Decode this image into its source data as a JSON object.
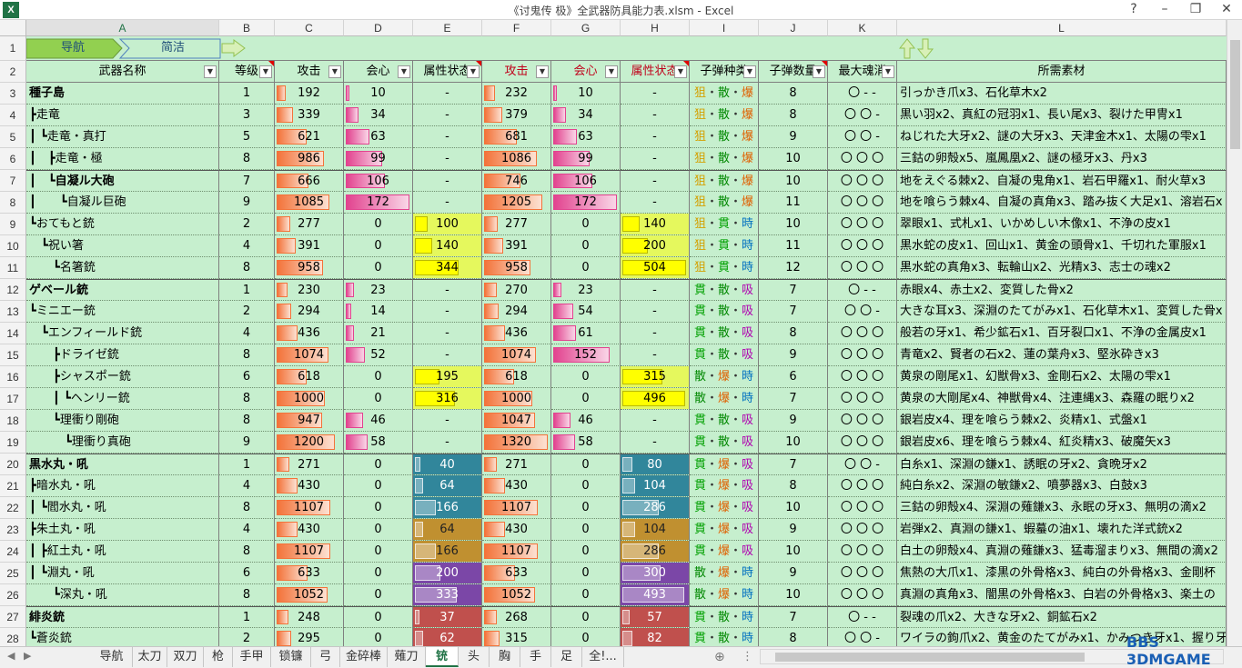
{
  "window": {
    "title": "《讨鬼传 极》全武器防具能力表.xlsm - Excel",
    "app_icon": "excel-icon",
    "buttons": [
      "?",
      "–",
      "❐",
      "✕"
    ]
  },
  "columns": [
    "A",
    "B",
    "C",
    "D",
    "E",
    "F",
    "G",
    "H",
    "I",
    "J",
    "K",
    "L"
  ],
  "row_numbers": [
    "1",
    "2",
    "3",
    "4",
    "5",
    "6",
    "7",
    "8",
    "9",
    "10",
    "11",
    "12",
    "13",
    "14",
    "15",
    "16",
    "17",
    "18",
    "19",
    "20",
    "21",
    "22",
    "23",
    "24",
    "25",
    "26",
    "27",
    "28"
  ],
  "nav": {
    "nav_label": "导航",
    "simple_label": "简洁"
  },
  "headers": [
    "武器名称",
    "等级",
    "攻击",
    "会心",
    "属性状态",
    "攻击",
    "会心",
    "属性状态",
    "子弹种类",
    "子弹数量",
    "最大魂消",
    "所需素材"
  ],
  "rows": [
    {
      "name": "種子島",
      "lv": "1",
      "atk": "192",
      "crit": "10",
      "attr": "-",
      "atk2": "232",
      "crit2": "10",
      "attr2": "-",
      "bullet": [
        "狙",
        "散",
        "爆"
      ],
      "count": "8",
      "soul": "〇 - -",
      "mat": "引っかき爪x3、石化草木x2",
      "bold": true
    },
    {
      "name": "┣走竜",
      "lv": "3",
      "atk": "339",
      "crit": "34",
      "attr": "-",
      "atk2": "379",
      "crit2": "34",
      "attr2": "-",
      "bullet": [
        "狙",
        "散",
        "爆"
      ],
      "count": "8",
      "soul": "〇 〇 -",
      "mat": "黒い羽x2、真紅の冠羽x1、長い尾x3、裂けた甲冑x1"
    },
    {
      "name": "┃ ┗走竜・真打",
      "lv": "5",
      "atk": "621",
      "crit": "63",
      "attr": "-",
      "atk2": "681",
      "crit2": "63",
      "attr2": "-",
      "bullet": [
        "狙",
        "散",
        "爆"
      ],
      "count": "9",
      "soul": "〇 〇 -",
      "mat": "ねじれた大牙x2、謎の大牙x3、天津金木x1、太陽の雫x1"
    },
    {
      "name": "┃　┣走竜・極",
      "lv": "8",
      "atk": "986",
      "crit": "99",
      "attr": "-",
      "atk2": "1086",
      "crit2": "99",
      "attr2": "-",
      "bullet": [
        "狙",
        "散",
        "爆"
      ],
      "count": "10",
      "soul": "〇 〇 〇",
      "mat": "三鈷の卵殻x5、嵐鳳凰x2、謎の極牙x3、丹x3"
    },
    {
      "name": "┃　┗自凝ル大砲",
      "lv": "7",
      "atk": "666",
      "crit": "106",
      "attr": "-",
      "atk2": "746",
      "crit2": "106",
      "attr2": "-",
      "bullet": [
        "狙",
        "散",
        "爆"
      ],
      "count": "10",
      "soul": "〇 〇 〇",
      "mat": "地をえぐる棘x2、自凝の鬼角x1、岩石甲羅x1、耐火草x3",
      "bold": true
    },
    {
      "name": "┃　　┗自凝ル巨砲",
      "lv": "9",
      "atk": "1085",
      "crit": "172",
      "attr": "-",
      "atk2": "1205",
      "crit2": "172",
      "attr2": "-",
      "bullet": [
        "狙",
        "散",
        "爆"
      ],
      "count": "11",
      "soul": "〇 〇 〇",
      "mat": "地を喰らう棘x4、自凝の真角x3、踏み抜く大足x1、溶岩石x"
    },
    {
      "name": "┗おてもと銃",
      "lv": "2",
      "atk": "277",
      "crit": "0",
      "attr": "100",
      "atk2": "277",
      "crit2": "0",
      "attr2": "140",
      "bullet": [
        "狙",
        "貫",
        "時"
      ],
      "count": "10",
      "soul": "〇 〇 〇",
      "mat": "翠眼x1、式札x1、いかめしい木像x1、不浄の皮x1"
    },
    {
      "name": "　┗祝い箸",
      "lv": "4",
      "atk": "391",
      "crit": "0",
      "attr": "140",
      "atk2": "391",
      "crit2": "0",
      "attr2": "200",
      "bullet": [
        "狙",
        "貫",
        "時"
      ],
      "count": "11",
      "soul": "〇 〇 〇",
      "mat": "黒水蛇の皮x1、回山x1、黄金の頭骨x1、千切れた軍服x1"
    },
    {
      "name": "　　┗名箸銃",
      "lv": "8",
      "atk": "958",
      "crit": "0",
      "attr": "344",
      "atk2": "958",
      "crit2": "0",
      "attr2": "504",
      "bullet": [
        "狙",
        "貫",
        "時"
      ],
      "count": "12",
      "soul": "〇 〇 〇",
      "mat": "黒水蛇の真角x3、転輪山x2、光精x3、志士の魂x2"
    },
    {
      "name": "ゲベール銃",
      "lv": "1",
      "atk": "230",
      "crit": "23",
      "attr": "-",
      "atk2": "270",
      "crit2": "23",
      "attr2": "-",
      "bullet": [
        "貫",
        "散",
        "吸"
      ],
      "count": "7",
      "soul": "〇 - -",
      "mat": "赤眼x4、赤土x2、変質した骨x2",
      "bold": true
    },
    {
      "name": "┗ミニエー銃",
      "lv": "2",
      "atk": "294",
      "crit": "14",
      "attr": "-",
      "atk2": "294",
      "crit2": "54",
      "attr2": "-",
      "bullet": [
        "貫",
        "散",
        "吸"
      ],
      "count": "7",
      "soul": "〇 〇 -",
      "mat": "大きな耳x3、深淵のたてがみx1、石化草木x1、変質した骨x"
    },
    {
      "name": "　┗エンフィールド銃",
      "lv": "4",
      "atk": "436",
      "crit": "21",
      "attr": "-",
      "atk2": "436",
      "crit2": "61",
      "attr2": "-",
      "bullet": [
        "貫",
        "散",
        "吸"
      ],
      "count": "8",
      "soul": "〇 〇 〇",
      "mat": "般若の牙x1、希少鉱石x1、百牙裂口x1、不浄の金属皮x1"
    },
    {
      "name": "　　┣ドライゼ銃",
      "lv": "8",
      "atk": "1074",
      "crit": "52",
      "attr": "-",
      "atk2": "1074",
      "crit2": "152",
      "attr2": "-",
      "bullet": [
        "貫",
        "散",
        "吸"
      ],
      "count": "9",
      "soul": "〇 〇 〇",
      "mat": "青竜x2、賢者の石x2、蓮の葉舟x3、堅氷砕きx3"
    },
    {
      "name": "　　┣シャスポー銃",
      "lv": "6",
      "atk": "618",
      "crit": "0",
      "attr": "195",
      "atk2": "618",
      "crit2": "0",
      "attr2": "315",
      "bullet": [
        "散",
        "爆",
        "時"
      ],
      "count": "6",
      "soul": "〇 〇 〇",
      "mat": "黄泉の剛尾x1、幻獣骨x3、金剛石x2、太陽の雫x1"
    },
    {
      "name": "　　┃ ┗ヘンリー銃",
      "lv": "8",
      "atk": "1000",
      "crit": "0",
      "attr": "316",
      "atk2": "1000",
      "crit2": "0",
      "attr2": "496",
      "bullet": [
        "散",
        "爆",
        "時"
      ],
      "count": "7",
      "soul": "〇 〇 〇",
      "mat": "黄泉の大剛尾x4、神獣骨x4、注連縄x3、森羅の眠りx2"
    },
    {
      "name": "　　┗理衝り剛砲",
      "lv": "8",
      "atk": "947",
      "crit": "46",
      "attr": "-",
      "atk2": "1047",
      "crit2": "46",
      "attr2": "-",
      "bullet": [
        "貫",
        "散",
        "吸"
      ],
      "count": "9",
      "soul": "〇 〇 〇",
      "mat": "銀岩皮x4、理を喰らう棘x2、炎精x1、式盤x1"
    },
    {
      "name": "　　　┗理衝り真砲",
      "lv": "9",
      "atk": "1200",
      "crit": "58",
      "attr": "-",
      "atk2": "1320",
      "crit2": "58",
      "attr2": "-",
      "bullet": [
        "貫",
        "散",
        "吸"
      ],
      "count": "10",
      "soul": "〇 〇 〇",
      "mat": "銀岩皮x6、理を喰らう棘x4、紅炎精x3、破魔矢x3"
    },
    {
      "name": "黒水丸・吼",
      "lv": "1",
      "atk": "271",
      "crit": "0",
      "attr": "40",
      "atk2": "271",
      "crit2": "0",
      "attr2": "80",
      "bullet": [
        "貫",
        "爆",
        "吸"
      ],
      "count": "7",
      "soul": "〇 〇 -",
      "mat": "白糸x1、深淵の鎌x1、誘眠の牙x2、貪晩牙x2",
      "bold": true
    },
    {
      "name": "┣暗水丸・吼",
      "lv": "4",
      "atk": "430",
      "crit": "0",
      "attr": "64",
      "atk2": "430",
      "crit2": "0",
      "attr2": "104",
      "bullet": [
        "貫",
        "爆",
        "吸"
      ],
      "count": "8",
      "soul": "〇 〇 〇",
      "mat": "純白糸x2、深淵の敏鎌x2、噴夢器x3、白鼓x3"
    },
    {
      "name": "┃ ┗閻水丸・吼",
      "lv": "8",
      "atk": "1107",
      "crit": "0",
      "attr": "166",
      "atk2": "1107",
      "crit2": "0",
      "attr2": "286",
      "bullet": [
        "貫",
        "爆",
        "吸"
      ],
      "count": "10",
      "soul": "〇 〇 〇",
      "mat": "三鈷の卵殻x4、深淵の薙鎌x3、永眠の牙x3、無明の滴x2"
    },
    {
      "name": "┣朱土丸・吼",
      "lv": "4",
      "atk": "430",
      "crit": "0",
      "attr": "64",
      "atk2": "430",
      "crit2": "0",
      "attr2": "104",
      "bullet": [
        "貫",
        "爆",
        "吸"
      ],
      "count": "9",
      "soul": "〇 〇 〇",
      "mat": "岩弾x2、真淵の鎌x1、蝦蟇の油x1、壊れた洋式銃x2"
    },
    {
      "name": "┃ ┣紅土丸・吼",
      "lv": "8",
      "atk": "1107",
      "crit": "0",
      "attr": "166",
      "atk2": "1107",
      "crit2": "0",
      "attr2": "286",
      "bullet": [
        "貫",
        "爆",
        "吸"
      ],
      "count": "10",
      "soul": "〇 〇 〇",
      "mat": "白土の卵殻x4、真淵の薙鎌x3、猛毒溜まりx3、無間の滴x2"
    },
    {
      "name": "┃ ┗淵丸・吼",
      "lv": "6",
      "atk": "633",
      "crit": "0",
      "attr": "200",
      "atk2": "633",
      "crit2": "0",
      "attr2": "300",
      "bullet": [
        "散",
        "爆",
        "時"
      ],
      "count": "9",
      "soul": "〇 〇 〇",
      "mat": "焦熱の大爪x1、漆黒の外骨格x3、純白の外骨格x3、金剛杯"
    },
    {
      "name": "　　┗深丸・吼",
      "lv": "8",
      "atk": "1052",
      "crit": "0",
      "attr": "333",
      "atk2": "1052",
      "crit2": "0",
      "attr2": "493",
      "bullet": [
        "散",
        "爆",
        "時"
      ],
      "count": "10",
      "soul": "〇 〇 〇",
      "mat": "真淵の真角x3、闇黒の外骨格x3、白岩の外骨格x3、楽土の"
    },
    {
      "name": "緋炎銃",
      "lv": "1",
      "atk": "248",
      "crit": "0",
      "attr": "37",
      "atk2": "268",
      "crit2": "0",
      "attr2": "57",
      "bullet": [
        "貫",
        "散",
        "時"
      ],
      "count": "7",
      "soul": "〇 - -",
      "mat": "裂魂の爪x2、大きな牙x2、銅鉱石x2",
      "bold": true
    },
    {
      "name": "┗蒼炎銃",
      "lv": "2",
      "atk": "295",
      "crit": "0",
      "attr": "62",
      "atk2": "315",
      "crit2": "0",
      "attr2": "82",
      "bullet": [
        "貫",
        "散",
        "時"
      ],
      "count": "8",
      "soul": "〇 〇 -",
      "mat": "ワイラの鉤爪x2、黄金のたてがみx1、かみつき牙x1、握り牙x1"
    }
  ],
  "sheet_tabs": [
    "导航",
    "太刀",
    "双刀",
    "枪",
    "手甲",
    "锁镰",
    "弓",
    "金碎棒",
    "薙刀",
    "铳",
    "头",
    "胸",
    "手",
    "足",
    "全!..."
  ],
  "active_tab": "铳",
  "watermark": "BBS 3DMGAME",
  "colors": {
    "grid_bg": "#c6efce",
    "atk_bar": "#f3733a",
    "crit_bar": "#e2438f",
    "accent": "#217346"
  }
}
